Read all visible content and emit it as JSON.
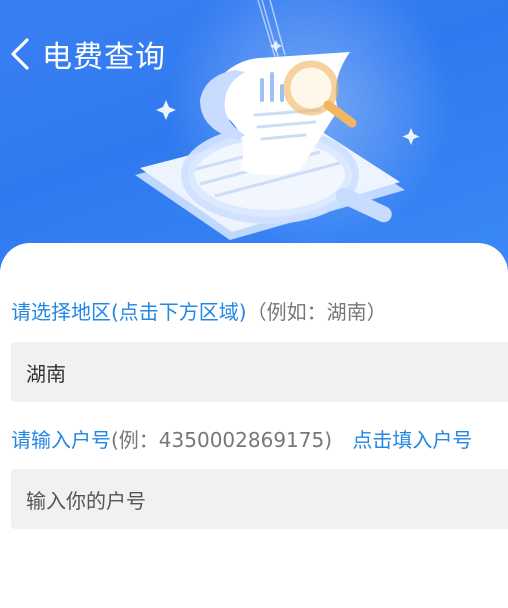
{
  "header": {
    "title": "电费查询"
  },
  "form": {
    "region_label": "请选择地区(点击下方区域)",
    "region_hint": "（例如：湖南）",
    "region_value": "湖南",
    "account_label": "请输入户号",
    "account_hint": "(例：4350002869175)",
    "account_fill_link": "点击填入户号",
    "account_placeholder": "输入你的户号"
  },
  "colors": {
    "hero": "#2f7af0",
    "accent": "#2287e6"
  }
}
